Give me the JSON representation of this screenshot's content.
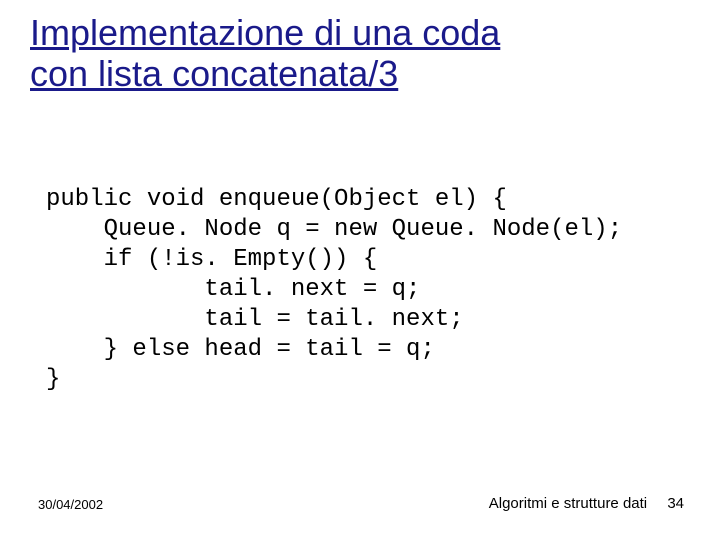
{
  "title_line1": "Implementazione di una coda",
  "title_line2": "con lista concatenata/3",
  "code": "public void enqueue(Object el) {\n    Queue. Node q = new Queue. Node(el);\n    if (!is. Empty()) {\n           tail. next = q;\n           tail = tail. next;\n    } else head = tail = q;\n}",
  "footer": {
    "date": "30/04/2002",
    "label": "Algoritmi e strutture dati",
    "page": "34"
  }
}
